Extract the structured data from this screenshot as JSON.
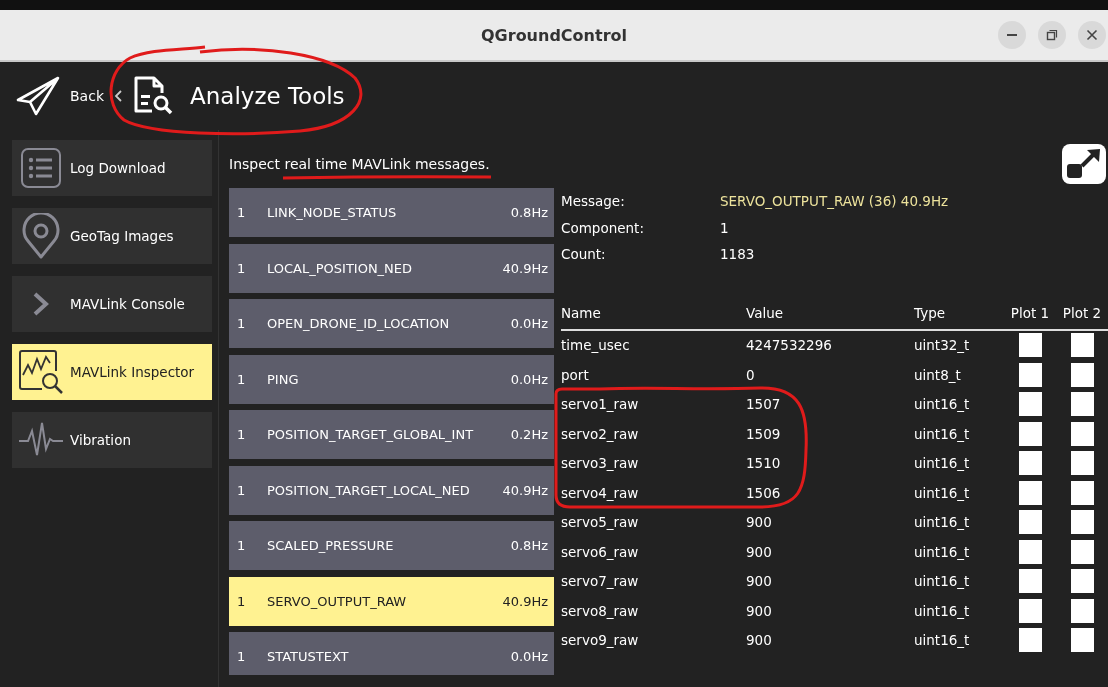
{
  "window": {
    "title": "QGroundControl"
  },
  "toolbar": {
    "back_label": "Back",
    "title": "Analyze Tools"
  },
  "sidebar": {
    "items": [
      {
        "label": "Log Download",
        "kind": "list",
        "selected": false
      },
      {
        "label": "GeoTag Images",
        "kind": "pin",
        "selected": false
      },
      {
        "label": "MAVLink Console",
        "kind": "chevron",
        "selected": false
      },
      {
        "label": "MAVLink Inspector",
        "kind": "chart",
        "selected": true
      },
      {
        "label": "Vibration",
        "kind": "wave",
        "selected": false
      }
    ]
  },
  "description": "Inspect real time MAVLink messages.",
  "messages": [
    {
      "component": "1",
      "name": "LINK_NODE_STATUS",
      "rate": "0.8Hz",
      "selected": false
    },
    {
      "component": "1",
      "name": "LOCAL_POSITION_NED",
      "rate": "40.9Hz",
      "selected": false
    },
    {
      "component": "1",
      "name": "OPEN_DRONE_ID_LOCATION",
      "rate": "0.0Hz",
      "selected": false
    },
    {
      "component": "1",
      "name": "PING",
      "rate": "0.0Hz",
      "selected": false
    },
    {
      "component": "1",
      "name": "POSITION_TARGET_GLOBAL_INT",
      "rate": "0.2Hz",
      "selected": false
    },
    {
      "component": "1",
      "name": "POSITION_TARGET_LOCAL_NED",
      "rate": "40.9Hz",
      "selected": false
    },
    {
      "component": "1",
      "name": "SCALED_PRESSURE",
      "rate": "0.8Hz",
      "selected": false
    },
    {
      "component": "1",
      "name": "SERVO_OUTPUT_RAW",
      "rate": "40.9Hz",
      "selected": true
    },
    {
      "component": "1",
      "name": "STATUSTEXT",
      "rate": "0.0Hz",
      "selected": false
    }
  ],
  "details": {
    "fields": [
      {
        "label": "Message:",
        "value": "SERVO_OUTPUT_RAW (36) 40.9Hz",
        "highlighted": true
      },
      {
        "label": "Component:",
        "value": "1",
        "highlighted": false
      },
      {
        "label": "Count:",
        "value": "1183",
        "highlighted": false
      }
    ],
    "table": {
      "columns": [
        "Name",
        "Value",
        "Type",
        "Plot 1",
        "Plot 2"
      ],
      "rows": [
        {
          "name": "time_usec",
          "value": "4247532296",
          "type": "uint32_t",
          "plot_1": false,
          "plot_2": false
        },
        {
          "name": "port",
          "value": "0",
          "type": "uint8_t",
          "plot_1": false,
          "plot_2": false
        },
        {
          "name": "servo1_raw",
          "value": "1507",
          "type": "uint16_t",
          "plot_1": false,
          "plot_2": false
        },
        {
          "name": "servo2_raw",
          "value": "1509",
          "type": "uint16_t",
          "plot_1": false,
          "plot_2": false
        },
        {
          "name": "servo3_raw",
          "value": "1510",
          "type": "uint16_t",
          "plot_1": false,
          "plot_2": false
        },
        {
          "name": "servo4_raw",
          "value": "1506",
          "type": "uint16_t",
          "plot_1": false,
          "plot_2": false
        },
        {
          "name": "servo5_raw",
          "value": "900",
          "type": "uint16_t",
          "plot_1": false,
          "plot_2": false
        },
        {
          "name": "servo6_raw",
          "value": "900",
          "type": "uint16_t",
          "plot_1": false,
          "plot_2": false
        },
        {
          "name": "servo7_raw",
          "value": "900",
          "type": "uint16_t",
          "plot_1": false,
          "plot_2": false
        },
        {
          "name": "servo8_raw",
          "value": "900",
          "type": "uint16_t",
          "plot_1": false,
          "plot_2": false
        },
        {
          "name": "servo9_raw",
          "value": "900",
          "type": "uint16_t",
          "plot_1": false,
          "plot_2": false
        }
      ]
    }
  }
}
